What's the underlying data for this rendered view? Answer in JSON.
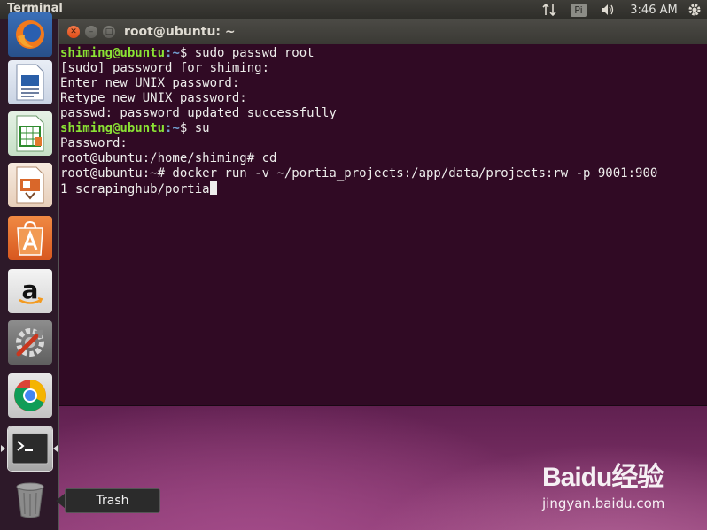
{
  "top_panel": {
    "app_title": "Terminal",
    "input_indicator": "Pi",
    "clock": "3:46 AM"
  },
  "launcher": {
    "items": [
      {
        "name": "Firefox Web Browser",
        "icon": "firefox-icon"
      },
      {
        "name": "LibreOffice Writer",
        "icon": "writer-icon"
      },
      {
        "name": "LibreOffice Calc",
        "icon": "calc-icon"
      },
      {
        "name": "LibreOffice Impress",
        "icon": "impress-icon"
      },
      {
        "name": "Ubuntu Software",
        "icon": "software-center-icon"
      },
      {
        "name": "Amazon",
        "icon": "amazon-icon"
      },
      {
        "name": "System Settings",
        "icon": "settings-icon"
      },
      {
        "name": "Google Chrome",
        "icon": "chrome-icon"
      },
      {
        "name": "Terminal",
        "icon": "terminal-icon"
      },
      {
        "name": "Trash",
        "icon": "trash-icon"
      }
    ],
    "tooltip": "Trash"
  },
  "terminal": {
    "title": "root@ubuntu: ~",
    "lines": [
      {
        "user": "shiming@ubuntu",
        "path": ":~",
        "text": "$ sudo passwd root"
      },
      {
        "text": "[sudo] password for shiming:"
      },
      {
        "text": "Enter new UNIX password:"
      },
      {
        "text": "Retype new UNIX password:"
      },
      {
        "text": "passwd: password updated successfully"
      },
      {
        "user": "shiming@ubuntu",
        "path": ":~",
        "text": "$ su"
      },
      {
        "text": "Password:"
      },
      {
        "text": "root@ubuntu:/home/shiming# cd"
      },
      {
        "text": "root@ubuntu:~# docker run -v ~/portia_projects:/app/data/projects:rw -p 9001:900"
      },
      {
        "text": "1 scrapinghub/portia",
        "cursor": true
      }
    ]
  },
  "watermark": {
    "logo": "Baidu经验",
    "url": "jingyan.baidu.com"
  },
  "colors": {
    "terminal_bg": "#300a24",
    "prompt_user": "#8ae234",
    "prompt_path": "#729fcf",
    "close_button": "#df4b16"
  }
}
